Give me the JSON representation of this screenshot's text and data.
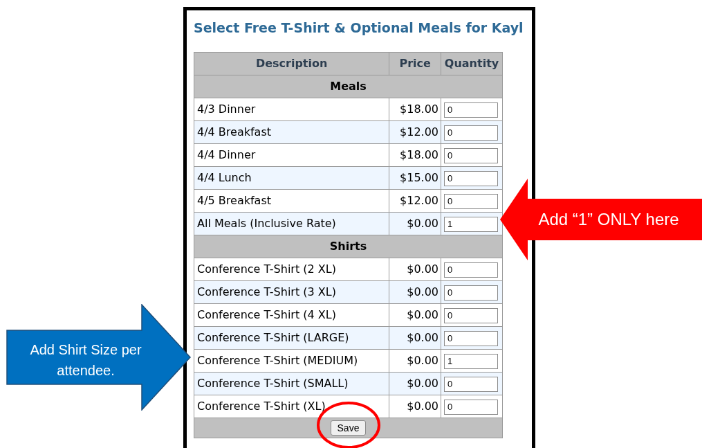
{
  "page": {
    "title": "Select Free T-Shirt & Optional Meals for Kayl"
  },
  "table": {
    "columns": [
      "Description",
      "Price",
      "Quantity"
    ],
    "sections": [
      {
        "title": "Meals",
        "rows": [
          {
            "description": "4/3 Dinner",
            "price": "$18.00",
            "quantity": "0"
          },
          {
            "description": "4/4 Breakfast",
            "price": "$12.00",
            "quantity": "0"
          },
          {
            "description": "4/4 Dinner",
            "price": "$18.00",
            "quantity": "0"
          },
          {
            "description": "4/4 Lunch",
            "price": "$15.00",
            "quantity": "0"
          },
          {
            "description": "4/5 Breakfast",
            "price": "$12.00",
            "quantity": "0"
          },
          {
            "description": "All Meals (Inclusive Rate)",
            "price": "$0.00",
            "quantity": "1"
          }
        ]
      },
      {
        "title": "Shirts",
        "rows": [
          {
            "description": "Conference T-Shirt (2 XL)",
            "price": "$0.00",
            "quantity": "0"
          },
          {
            "description": "Conference T-Shirt (3 XL)",
            "price": "$0.00",
            "quantity": "0"
          },
          {
            "description": "Conference T-Shirt (4 XL)",
            "price": "$0.00",
            "quantity": "0"
          },
          {
            "description": "Conference T-Shirt (LARGE)",
            "price": "$0.00",
            "quantity": "0"
          },
          {
            "description": "Conference T-Shirt (MEDIUM)",
            "price": "$0.00",
            "quantity": "1"
          },
          {
            "description": "Conference T-Shirt (SMALL)",
            "price": "$0.00",
            "quantity": "0"
          },
          {
            "description": "Conference T-Shirt (XL)",
            "price": "$0.00",
            "quantity": "0"
          }
        ]
      }
    ],
    "save_button": "Save"
  },
  "annotations": [
    {
      "kind": "arrow-left",
      "text": "Add “1” ONLY here",
      "color": "#ff0000"
    },
    {
      "kind": "arrow-right",
      "text": "Add Shirt Size per attendee.",
      "color": "#0070c0"
    },
    {
      "kind": "circle",
      "color": "#ff0000"
    }
  ]
}
